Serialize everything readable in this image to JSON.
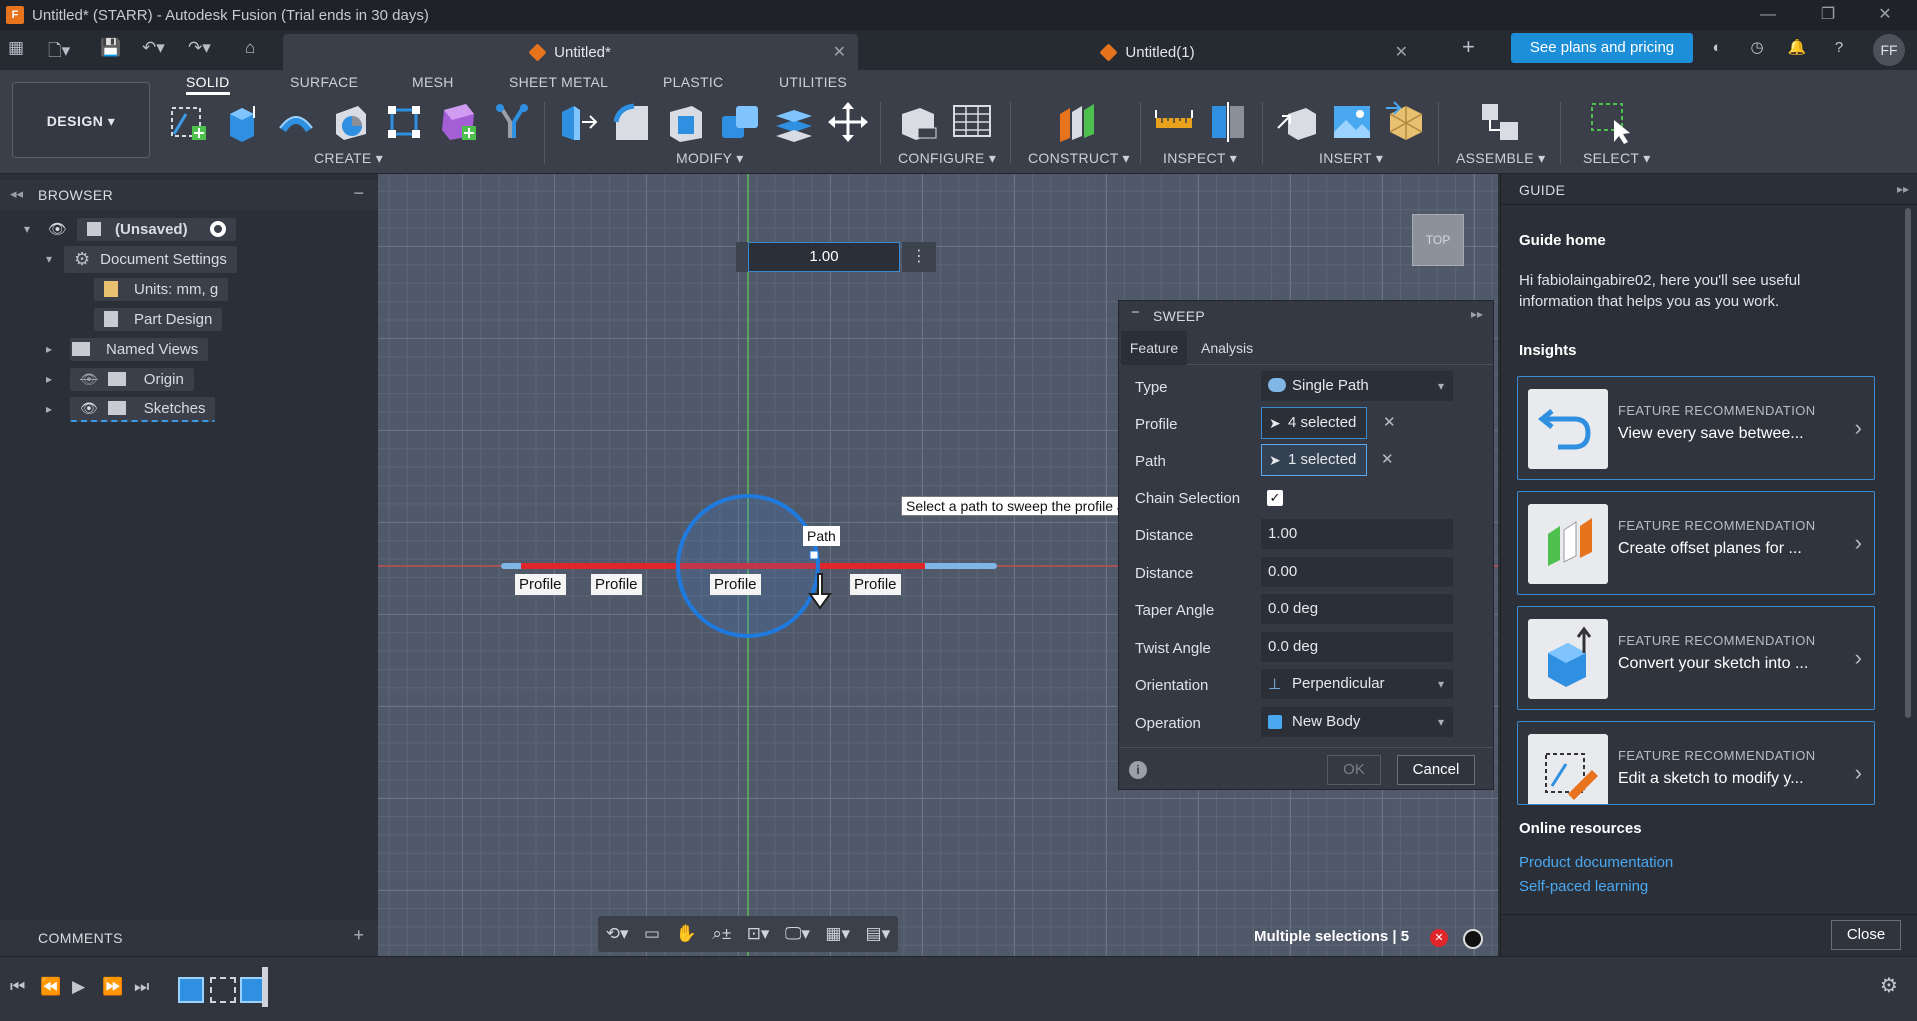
{
  "window": {
    "title": "Untitled* (STARR) - Autodesk Fusion (Trial ends in 30 days)"
  },
  "tabs": [
    {
      "label": "Untitled*"
    },
    {
      "label": "Untitled(1)"
    }
  ],
  "header": {
    "plans_label": "See plans and pricing",
    "avatar_initials": "FF"
  },
  "toolbar": {
    "workspace": "DESIGN",
    "ws_tabs": [
      "SOLID",
      "SURFACE",
      "MESH",
      "SHEET METAL",
      "PLASTIC",
      "UTILITIES"
    ],
    "groups": [
      "CREATE",
      "MODIFY",
      "CONFIGURE",
      "CONSTRUCT",
      "INSPECT",
      "INSERT",
      "ASSEMBLE",
      "SELECT"
    ]
  },
  "browser": {
    "title": "BROWSER",
    "root": "(Unsaved)",
    "items": [
      {
        "label": "Document Settings"
      },
      {
        "label": "Units: mm, g"
      },
      {
        "label": "Part Design"
      },
      {
        "label": "Named Views"
      },
      {
        "label": "Origin"
      },
      {
        "label": "Sketches"
      }
    ]
  },
  "canvas": {
    "dim_input": "1.00",
    "viewcube": "TOP",
    "tooltip": "Select a path to sweep the profile along",
    "path_tag": "Path",
    "profile_tags": [
      "Profile",
      "Profile",
      "Profile",
      "Profile"
    ],
    "status": "Multiple selections | 5"
  },
  "sweep": {
    "title": "SWEEP",
    "tabs": [
      "Feature",
      "Analysis"
    ],
    "rows": {
      "type_label": "Type",
      "type_value": "Single Path",
      "profile_label": "Profile",
      "profile_value": "4 selected",
      "path_label": "Path",
      "path_value": "1 selected",
      "chain_label": "Chain Selection",
      "distance1_label": "Distance",
      "distance1_value": "1.00",
      "distance2_label": "Distance",
      "distance2_value": "0.00",
      "taper_label": "Taper Angle",
      "taper_value": "0.0 deg",
      "twist_label": "Twist Angle",
      "twist_value": "0.0 deg",
      "orientation_label": "Orientation",
      "orientation_value": "Perpendicular",
      "operation_label": "Operation",
      "operation_value": "New Body"
    },
    "ok": "OK",
    "cancel": "Cancel"
  },
  "guide": {
    "title": "GUIDE",
    "home": "Guide home",
    "intro": "Hi fabiolaingabire02, here you'll see useful information that helps you as you work.",
    "insights": "Insights",
    "cards": [
      {
        "kicker": "FEATURE RECOMMENDATION",
        "title": "View every save betwee..."
      },
      {
        "kicker": "FEATURE RECOMMENDATION",
        "title": "Create offset planes for ..."
      },
      {
        "kicker": "FEATURE RECOMMENDATION",
        "title": "Convert your sketch into ..."
      },
      {
        "kicker": "FEATURE RECOMMENDATION",
        "title": "Edit a sketch to modify y..."
      }
    ],
    "online": "Online resources",
    "links": [
      "Product documentation",
      "Self-paced learning"
    ],
    "close": "Close"
  },
  "comments": {
    "label": "COMMENTS"
  }
}
